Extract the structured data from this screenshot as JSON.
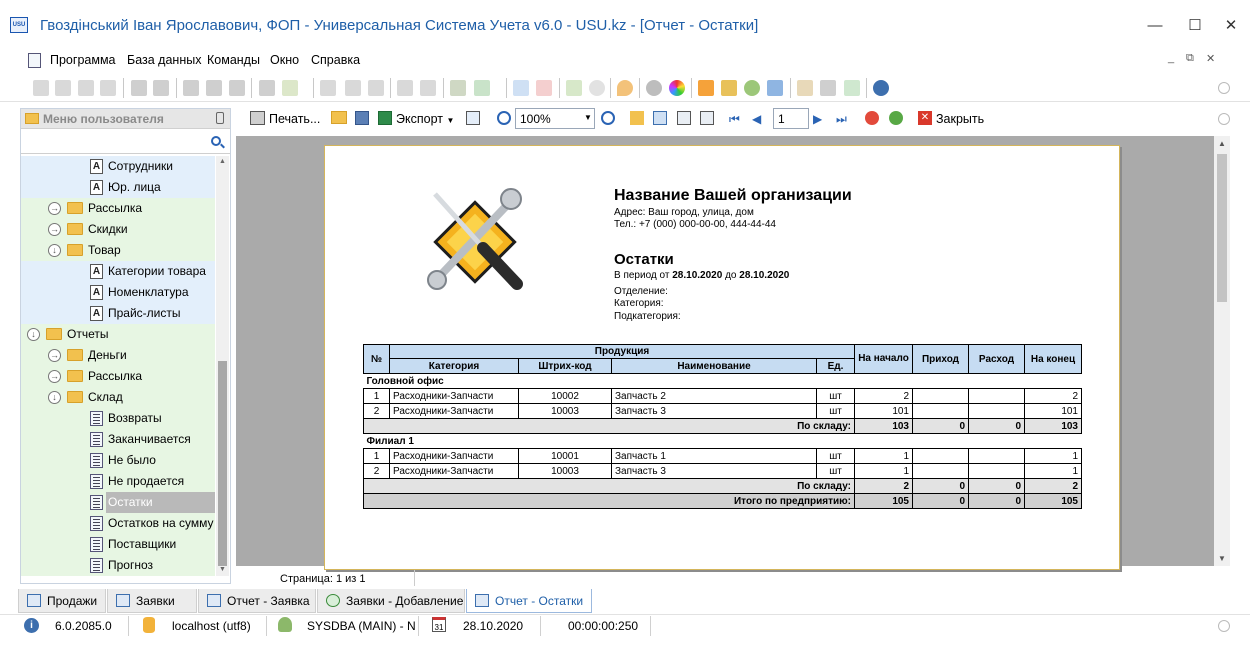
{
  "window": {
    "title": "Гвоздінський Іван Ярославович, ФОП - Универсальная Система Учета v6.0 - USU.kz - [Отчет - Остатки]",
    "app_icon_text": "USU",
    "minimize": "—",
    "maximize": "☐",
    "close": "✕"
  },
  "menu": {
    "items": [
      "Программа",
      "База данных",
      "Команды",
      "Окно",
      "Справка"
    ],
    "mdi_minimize": "_",
    "mdi_restore": "⧉",
    "mdi_close": "✕"
  },
  "sidebar": {
    "title": "Меню пользователя",
    "pin_icon": "pin-icon",
    "search_icon": "search-icon",
    "items": [
      {
        "label": "Сотрудники",
        "type": "doc",
        "level": 3
      },
      {
        "label": "Юр. лица",
        "type": "doc",
        "level": 3
      },
      {
        "label": "Рассылка",
        "type": "folder",
        "level": 2,
        "expander": "→"
      },
      {
        "label": "Скидки",
        "type": "folder",
        "level": 2,
        "expander": "→"
      },
      {
        "label": "Товар",
        "type": "folder",
        "level": 2,
        "expander": "↓"
      },
      {
        "label": "Категории товара",
        "type": "doc",
        "level": 3
      },
      {
        "label": "Номенклатура",
        "type": "doc",
        "level": 3
      },
      {
        "label": "Прайс-листы",
        "type": "doc",
        "level": 3
      },
      {
        "label": "Отчеты",
        "type": "folder",
        "level": 1,
        "expander": "↓"
      },
      {
        "label": "Деньги",
        "type": "folder",
        "level": 2,
        "expander": "→"
      },
      {
        "label": "Рассылка",
        "type": "folder",
        "level": 2,
        "expander": "→"
      },
      {
        "label": "Склад",
        "type": "folder",
        "level": 2,
        "expander": "↓"
      },
      {
        "label": "Возвраты",
        "type": "report",
        "level": 3
      },
      {
        "label": "Заканчивается",
        "type": "report",
        "level": 3
      },
      {
        "label": "Не было",
        "type": "report",
        "level": 3
      },
      {
        "label": "Не продается",
        "type": "report",
        "level": 3
      },
      {
        "label": "Остатки",
        "type": "report",
        "level": 3,
        "selected": true
      },
      {
        "label": "Остатков на сумму",
        "type": "report",
        "level": 3
      },
      {
        "label": "Поставщики",
        "type": "report",
        "level": 3
      },
      {
        "label": "Прогноз",
        "type": "report",
        "level": 3
      }
    ]
  },
  "report_toolbar": {
    "print_label": "Печать...",
    "export_label": "Экспорт",
    "zoom_value": "100%",
    "page_value": "1",
    "close_label": "Закрыть"
  },
  "report": {
    "org_name": "Название Вашей организации",
    "address": "Адрес: Ваш город, улица, дом",
    "phone": "Тел.: +7 (000) 000-00-00, 444-44-44",
    "title": "Остатки",
    "period_prefix": "В период от",
    "date_from": "28.10.2020",
    "period_mid": "до",
    "date_to": "28.10.2020",
    "branch_label": "Отделение:",
    "category_label": "Категория:",
    "subcategory_label": "Подкатегория:",
    "table": {
      "col_no": "№",
      "group_products": "Продукция",
      "col_category": "Категория",
      "col_barcode": "Штрих-код",
      "col_name": "Наименование",
      "col_unit": "Ед.",
      "col_start": "На начало",
      "col_in": "Приход",
      "col_out": "Расход",
      "col_end": "На конец",
      "groups": [
        {
          "name": "Головной офис",
          "rows": [
            {
              "no": "1",
              "category": "Расходники-Запчасти",
              "barcode": "10002",
              "name": "Запчасть 2",
              "unit": "шт",
              "start": "2",
              "in": "",
              "out": "",
              "end": "2"
            },
            {
              "no": "2",
              "category": "Расходники-Запчасти",
              "barcode": "10003",
              "name": "Запчасть 3",
              "unit": "шт",
              "start": "101",
              "in": "",
              "out": "",
              "end": "101"
            }
          ],
          "subtotal_label": "По складу:",
          "subtotal": {
            "start": "103",
            "in": "0",
            "out": "0",
            "end": "103"
          }
        },
        {
          "name": "Филиал 1",
          "rows": [
            {
              "no": "1",
              "category": "Расходники-Запчасти",
              "barcode": "10001",
              "name": "Запчасть 1",
              "unit": "шт",
              "start": "1",
              "in": "",
              "out": "",
              "end": "1"
            },
            {
              "no": "2",
              "category": "Расходники-Запчасти",
              "barcode": "10003",
              "name": "Запчасть 3",
              "unit": "шт",
              "start": "1",
              "in": "",
              "out": "",
              "end": "1"
            }
          ],
          "subtotal_label": "По складу:",
          "subtotal": {
            "start": "2",
            "in": "0",
            "out": "0",
            "end": "2"
          }
        }
      ],
      "total_label": "Итого по предприятию:",
      "total": {
        "start": "105",
        "in": "0",
        "out": "0",
        "end": "105"
      }
    }
  },
  "page_status": "Страница: 1 из 1",
  "tabs": [
    {
      "label": "Продажи"
    },
    {
      "label": "Заявки"
    },
    {
      "label": "Отчет - Заявка"
    },
    {
      "label": "Заявки - Добавление"
    },
    {
      "label": "Отчет - Остатки",
      "active": true
    }
  ],
  "statusbar": {
    "version": "6.0.2085.0",
    "db": "localhost (utf8)",
    "user": "SYSDBA (MAIN) - N",
    "calendar_day": "31",
    "date": "28.10.2020",
    "timer": "00:00:00:250"
  },
  "colors": {
    "accent": "#1f5fa8",
    "tree_green": "#e7f6e3",
    "tree_blue": "#e3effb",
    "selected": "#b9b9b9",
    "table_header": "#c6dcf2"
  }
}
